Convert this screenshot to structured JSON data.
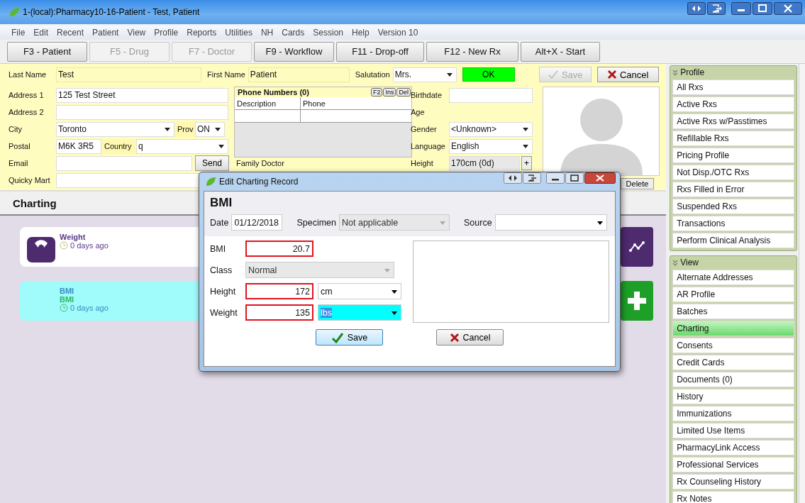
{
  "window": {
    "title": "1-(local):Pharmacy10-16-Patient - Test, Patient"
  },
  "menu": [
    "File",
    "Edit",
    "Recent",
    "Patient",
    "View",
    "Profile",
    "Reports",
    "Utilities",
    "NH",
    "Cards",
    "Session",
    "Help",
    "Version 10"
  ],
  "toolbar": [
    {
      "label": "F3 - Patient",
      "disabled": false
    },
    {
      "label": "F5 - Drug",
      "disabled": true
    },
    {
      "label": "F7 - Doctor",
      "disabled": true
    },
    {
      "label": "F9 - Workflow",
      "disabled": false
    },
    {
      "label": "F11 - Drop-off",
      "disabled": false
    },
    {
      "label": "F12 - New Rx",
      "disabled": false
    },
    {
      "label": "Alt+X - Start",
      "disabled": false
    }
  ],
  "patient": {
    "last_name": {
      "label": "Last Name",
      "value": "Test"
    },
    "first_name": {
      "label": "First Name",
      "value": "Patient"
    },
    "salutation": {
      "label": "Salutation",
      "value": "Mrs."
    },
    "ok_button": "OK",
    "save_button": {
      "label": "Save",
      "disabled": true
    },
    "cancel_button": "Cancel",
    "address1": {
      "label": "Address 1",
      "value": "125 Test Street"
    },
    "address2": {
      "label": "Address 2"
    },
    "city": {
      "label": "City",
      "value": "Toronto"
    },
    "prov": {
      "label": "Prov",
      "value": "ON"
    },
    "postal": {
      "label": "Postal",
      "value": "M6K 3R5"
    },
    "country": {
      "label": "Country",
      "value": "q"
    },
    "email": {
      "label": "Email"
    },
    "send_button": "Send",
    "quicky_mart": {
      "label": "Quicky Mart"
    },
    "phone_numbers": {
      "title": "Phone Numbers (0)",
      "keys": [
        "F2",
        "Ins",
        "Del"
      ],
      "columns": [
        "Description",
        "Phone"
      ]
    },
    "family_doctor": "Family Doctor",
    "birthdate": {
      "label": "Birthdate"
    },
    "age": {
      "label": "Age"
    },
    "gender": {
      "label": "Gender",
      "value": "<Unknown>"
    },
    "language": {
      "label": "Language",
      "value": "English"
    },
    "height": {
      "label": "Height",
      "value": "170cm (0d)",
      "button": "+"
    },
    "delete_button": "Delete"
  },
  "charting": {
    "title": "Charting",
    "cards": [
      {
        "kind": "weight",
        "title": "Weight",
        "time": "0 days ago",
        "selected": false
      },
      {
        "kind": "bmi",
        "title": "BMI",
        "subtitle": "BMI",
        "time": "0 days ago",
        "selected": true
      }
    ]
  },
  "dialog": {
    "title": "Edit Charting Record",
    "heading": "BMI",
    "date": {
      "label": "Date",
      "value": "01/12/2018"
    },
    "specimen": {
      "label": "Specimen",
      "value": "Not applicable",
      "disabled": true
    },
    "source": {
      "label": "Source"
    },
    "bmi": {
      "label": "BMI",
      "value": "20.7",
      "error": true
    },
    "class": {
      "label": "Class",
      "value": "Normal",
      "disabled": true
    },
    "height": {
      "label": "Height",
      "value": "172",
      "error": true,
      "unit": "cm",
      "unit_focused": false
    },
    "weight": {
      "label": "Weight",
      "value": "135",
      "error": true,
      "unit": "lbs",
      "unit_focused": true
    },
    "save": "Save",
    "cancel": "Cancel"
  },
  "sidebar": [
    {
      "title": "Profile",
      "items": [
        {
          "label": "All Rxs",
          "selected": false
        },
        {
          "label": "Active Rxs",
          "selected": false
        },
        {
          "label": "Active Rxs w/Passtimes",
          "selected": false
        },
        {
          "label": "Refillable Rxs",
          "selected": false
        },
        {
          "label": "Pricing Profile",
          "selected": false
        },
        {
          "label": "Not Disp./OTC Rxs",
          "selected": false
        },
        {
          "label": "Rxs Filled in Error",
          "selected": false
        },
        {
          "label": "Suspended Rxs",
          "selected": false
        },
        {
          "label": "Transactions",
          "selected": false
        },
        {
          "label": "Perform Clinical Analysis",
          "selected": false
        }
      ]
    },
    {
      "title": "View",
      "items": [
        {
          "label": "Alternate Addresses",
          "selected": false
        },
        {
          "label": "AR Profile",
          "selected": false
        },
        {
          "label": "Batches",
          "selected": false
        },
        {
          "label": "Charting",
          "selected": true
        },
        {
          "label": "Consents",
          "selected": false
        },
        {
          "label": "Credit Cards",
          "selected": false
        },
        {
          "label": "Documents (0)",
          "selected": false
        },
        {
          "label": "History",
          "selected": false
        },
        {
          "label": "Immunizations",
          "selected": false
        },
        {
          "label": "Limited Use Items",
          "selected": false
        },
        {
          "label": "PharmacyLink Access",
          "selected": false
        },
        {
          "label": "Professional Services",
          "selected": false
        },
        {
          "label": "Rx Counseling History",
          "selected": false
        },
        {
          "label": "Rx Notes",
          "selected": false
        }
      ]
    }
  ]
}
